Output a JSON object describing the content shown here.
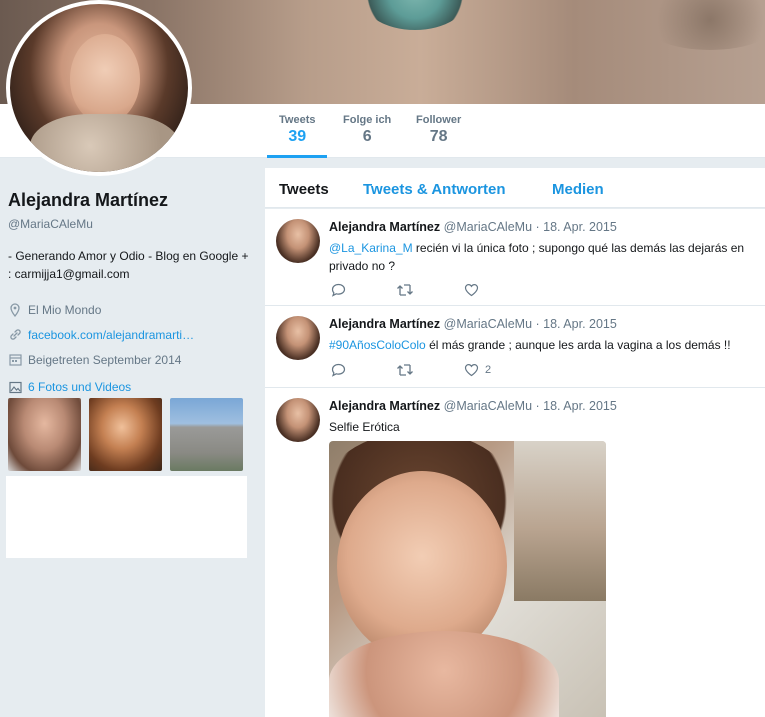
{
  "stats": [
    {
      "label": "Tweets",
      "value": "39"
    },
    {
      "label": "Folge ich",
      "value": "6"
    },
    {
      "label": "Follower",
      "value": "78"
    }
  ],
  "profile": {
    "name": "Alejandra Martínez",
    "handle": "@MariaCAleMu",
    "bio": "- Generando Amor y Odio - Blog en Google + : carmijja1@gmail.com",
    "location": "El Mio Mondo",
    "website": "facebook.com/alejandramarti…",
    "joined": "Beigetreten September 2014",
    "photos_label": "6 Fotos und Videos"
  },
  "tabs": [
    "Tweets",
    "Tweets & Antworten",
    "Medien"
  ],
  "tweets": [
    {
      "name": "Alejandra Martínez",
      "handle": "@MariaCAleMu",
      "date": "· 18. Apr. 2015",
      "mention": "@La_Karina_M",
      "text": "  recién vi la única foto ; supongo qué las demás las dejarás en privado no ?",
      "likes": ""
    },
    {
      "name": "Alejandra Martínez",
      "handle": "@MariaCAleMu",
      "date": "· 18. Apr. 2015",
      "hashtag": "#90AñosColoColo",
      "text": " él más grande ; aunque les arda la vagina a los demás !!",
      "likes": "2"
    },
    {
      "name": "Alejandra Martínez",
      "handle": "@MariaCAleMu",
      "date": "· 18. Apr. 2015",
      "text": "Selfie Erótica"
    }
  ],
  "colors": {
    "accent": "#1da1f2",
    "link": "#1b95e0",
    "muted": "#657786",
    "background": "#e6ecf0"
  }
}
